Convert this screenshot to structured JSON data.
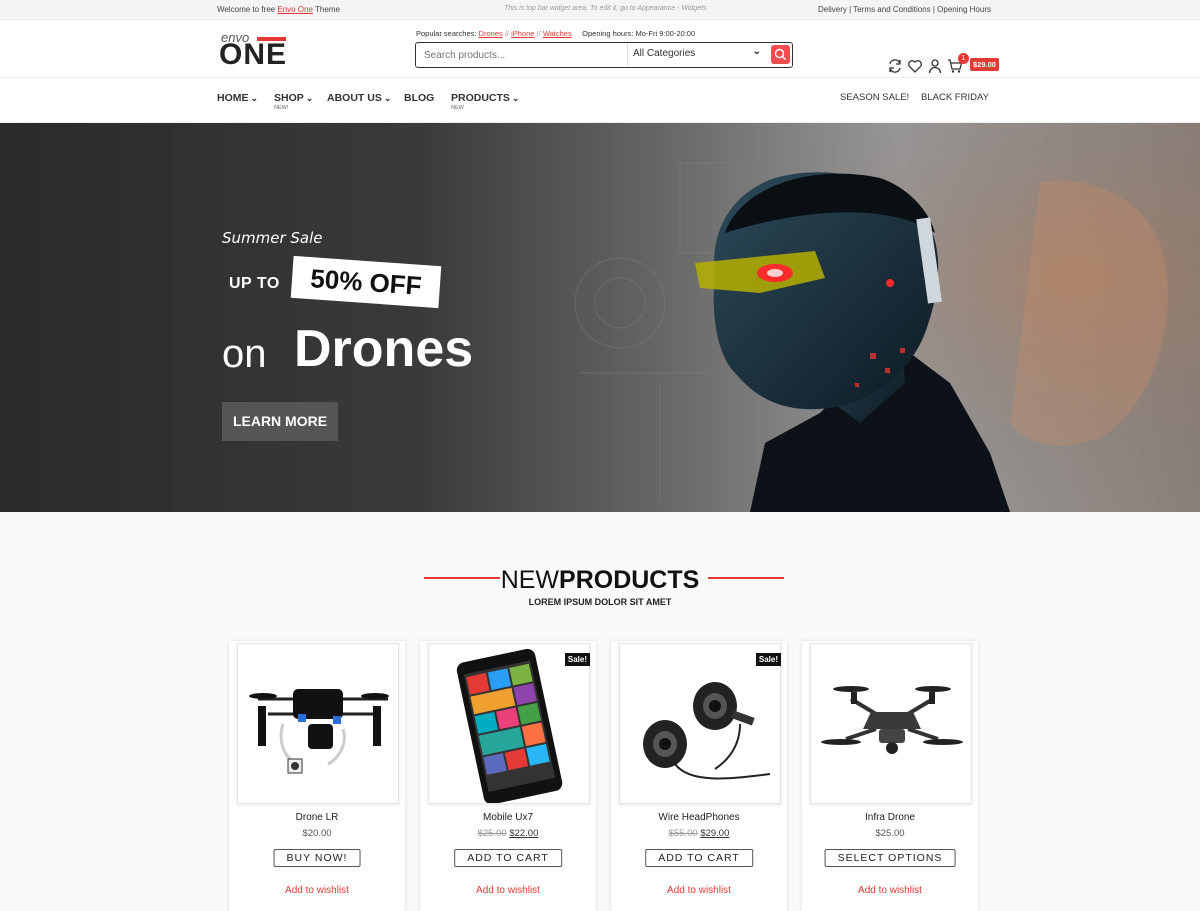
{
  "topbar": {
    "welcome_prefix": "Welcome to free",
    "welcome_link": "Envo One",
    "welcome_suffix": "Theme",
    "center_note": "This is top bar widget area. To edit it, go to Appearance - Widgets",
    "right_links": "Delivery | Terms and Conditions | Opening Hours"
  },
  "header": {
    "logo_small": "envo",
    "logo_big": "ONE",
    "popular_label": "Popular searches:",
    "popular_items": [
      "Drones",
      "iPhone",
      "Watches"
    ],
    "opening_hours": "Opening hours: Mo-Fri 9:00-20:00",
    "search_placeholder": "Search products...",
    "category_selected": "All Categories",
    "cart_count": "1",
    "cart_total": "$29.00",
    "icons": [
      "compare-icon",
      "heart-icon",
      "user-icon",
      "cart-icon"
    ]
  },
  "nav": {
    "items": [
      {
        "label": "Home",
        "sub": ""
      },
      {
        "label": "Shop",
        "sub": "NEW!"
      },
      {
        "label": "About Us",
        "sub": ""
      },
      {
        "label": "Blog",
        "sub": ""
      },
      {
        "label": "Products",
        "sub": "NEW"
      }
    ],
    "right": [
      "Season Sale!",
      "Black Friday"
    ]
  },
  "hero": {
    "subtitle": "Summer Sale",
    "up_to": "UP TO",
    "off": "50% OFF",
    "on": "on",
    "product": "Drones",
    "button": "LEARN MORE"
  },
  "products_section": {
    "title_light": "NEW",
    "title_bold": "PRODUCTS",
    "subtitle": "LOREM IPSUM DOLOR SIT AMET",
    "items": [
      {
        "name": "Drone LR",
        "price": "$20.00",
        "old_price": "",
        "sale": "",
        "cta": "BUY NOW!",
        "wishlist": "Add to wishlist"
      },
      {
        "name": "Mobile Ux7",
        "price": "$22.00",
        "old_price": "$25.00",
        "sale": "Sale!",
        "cta": "ADD TO CART",
        "wishlist": "Add to wishlist"
      },
      {
        "name": "Wire HeadPhones",
        "price": "$29.00",
        "old_price": "$55.00",
        "sale": "Sale!",
        "cta": "ADD TO CART",
        "wishlist": "Add to wishlist"
      },
      {
        "name": "Infra Drone",
        "price": "$25.00",
        "old_price": "",
        "sale": "",
        "cta": "SELECT OPTIONS",
        "wishlist": "Add to wishlist"
      }
    ]
  },
  "colors": {
    "accent": "#e53935",
    "dark": "#222222"
  }
}
